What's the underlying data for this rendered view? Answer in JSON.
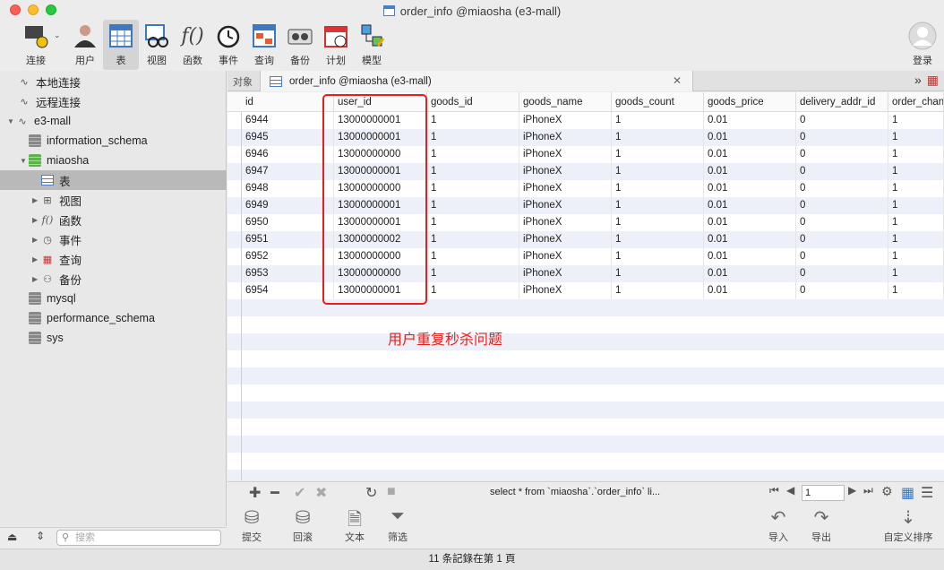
{
  "window": {
    "title": "order_info @miaosha (e3-mall)"
  },
  "toolbar": {
    "items": [
      {
        "label": "连接",
        "icon": "connection-icon"
      },
      {
        "label": "用户",
        "icon": "user-icon"
      },
      {
        "label": "表",
        "icon": "table-icon"
      },
      {
        "label": "视图",
        "icon": "view-icon"
      },
      {
        "label": "函数",
        "icon": "function-icon"
      },
      {
        "label": "事件",
        "icon": "event-icon"
      },
      {
        "label": "查询",
        "icon": "query-icon"
      },
      {
        "label": "备份",
        "icon": "backup-icon"
      },
      {
        "label": "计划",
        "icon": "schedule-icon"
      },
      {
        "label": "模型",
        "icon": "model-icon"
      }
    ],
    "login_label": "登录"
  },
  "sidebar": {
    "items": [
      {
        "label": "本地连接"
      },
      {
        "label": "远程连接"
      },
      {
        "label": "e3-mall"
      },
      {
        "label": "information_schema"
      },
      {
        "label": "miaosha"
      },
      {
        "label": "表"
      },
      {
        "label": "视图"
      },
      {
        "label": "函数"
      },
      {
        "label": "事件"
      },
      {
        "label": "查询"
      },
      {
        "label": "备份"
      },
      {
        "label": "mysql"
      },
      {
        "label": "performance_schema"
      },
      {
        "label": "sys"
      }
    ],
    "search_placeholder": "搜索"
  },
  "tabs": {
    "objects_label": "对象",
    "active_tab": "order_info @miaosha (e3-mall)"
  },
  "table": {
    "columns": [
      "id",
      "user_id",
      "goods_id",
      "goods_name",
      "goods_count",
      "goods_price",
      "delivery_addr_id",
      "order_chan"
    ],
    "rows": [
      [
        "6944",
        "13000000001",
        "1",
        "iPhoneX",
        "1",
        "0.01",
        "0",
        "1"
      ],
      [
        "6945",
        "13000000001",
        "1",
        "iPhoneX",
        "1",
        "0.01",
        "0",
        "1"
      ],
      [
        "6946",
        "13000000000",
        "1",
        "iPhoneX",
        "1",
        "0.01",
        "0",
        "1"
      ],
      [
        "6947",
        "13000000001",
        "1",
        "iPhoneX",
        "1",
        "0.01",
        "0",
        "1"
      ],
      [
        "6948",
        "13000000000",
        "1",
        "iPhoneX",
        "1",
        "0.01",
        "0",
        "1"
      ],
      [
        "6949",
        "13000000001",
        "1",
        "iPhoneX",
        "1",
        "0.01",
        "0",
        "1"
      ],
      [
        "6950",
        "13000000001",
        "1",
        "iPhoneX",
        "1",
        "0.01",
        "0",
        "1"
      ],
      [
        "6951",
        "13000000002",
        "1",
        "iPhoneX",
        "1",
        "0.01",
        "0",
        "1"
      ],
      [
        "6952",
        "13000000000",
        "1",
        "iPhoneX",
        "1",
        "0.01",
        "0",
        "1"
      ],
      [
        "6953",
        "13000000000",
        "1",
        "iPhoneX",
        "1",
        "0.01",
        "0",
        "1"
      ],
      [
        "6954",
        "13000000001",
        "1",
        "iPhoneX",
        "1",
        "0.01",
        "0",
        "1"
      ]
    ],
    "annotation": "用户重复秒杀问题"
  },
  "actionbar": {
    "sql_text": "select * from `miaosha`.`order_info`  li...",
    "page_value": "1"
  },
  "bottom_buttons": {
    "commit": "提交",
    "rollback": "回滚",
    "text": "文本",
    "filter": "筛选",
    "import": "导入",
    "export": "导出",
    "custom_sort": "自定义排序"
  },
  "status": {
    "text": "11 条記錄在第 1 頁"
  },
  "colors": {
    "annotation_red": "#e8201c",
    "row_alt": "#edf0f8"
  }
}
